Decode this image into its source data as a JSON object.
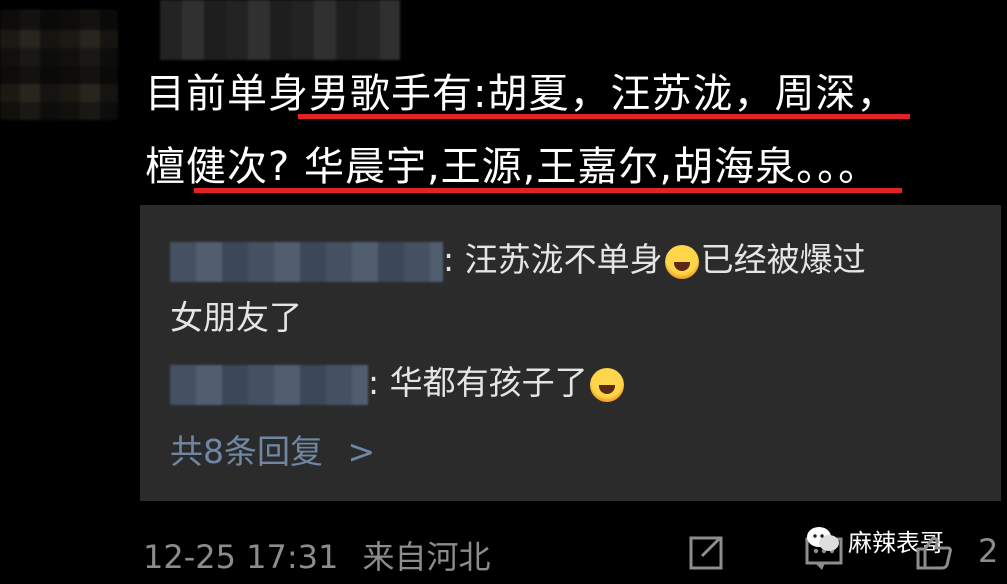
{
  "comment": {
    "line1": "目前单身男歌手有:胡夏，汪苏泷，周深，",
    "line2": "檀健次? 华晨宇,王源,王嘉尔,胡海泉。。。"
  },
  "replies": [
    {
      "text_a": ": 汪苏泷不单身",
      "emoji": "laughing-crying-emoji",
      "text_b": "已经被爆过",
      "text_c": "女朋友了"
    },
    {
      "text_a": ": 华都有孩子了",
      "emoji": "laughing-emoji"
    }
  ],
  "more_replies": "共8条回复",
  "more_chevron": ">",
  "footer": {
    "timestamp": "12-25 17:31",
    "location": "来自河北",
    "comment_count": "2"
  },
  "watermark": {
    "label": "麻辣表哥"
  },
  "icons": {
    "share": "share-icon",
    "comment": "comment-icon",
    "like": "like-icon",
    "watermark": "wechat-icon"
  },
  "colors": {
    "underline": "#e32222",
    "link": "#6f87a3",
    "reply_bg": "#2b2b2b"
  }
}
